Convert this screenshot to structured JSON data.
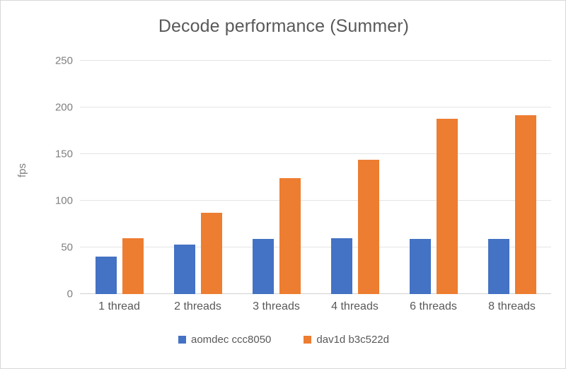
{
  "chart_data": {
    "type": "bar",
    "title": "Decode performance (Summer)",
    "xlabel": "",
    "ylabel": "fps",
    "categories": [
      "1 thread",
      "2 threads",
      "3 threads",
      "4 threads",
      "6 threads",
      "8 threads"
    ],
    "series": [
      {
        "name": "aomdec ccc8050",
        "color": "#4472C4",
        "values": [
          40,
          53,
          59,
          60,
          59,
          59
        ]
      },
      {
        "name": "dav1d b3c522d",
        "color": "#ED7D31",
        "values": [
          60,
          87,
          124,
          144,
          188,
          192
        ]
      }
    ],
    "ylim": [
      0,
      250
    ],
    "y_ticks": [
      0,
      50,
      100,
      150,
      200,
      250
    ],
    "y_tick_labels": [
      "0",
      "50",
      "100",
      "150",
      "200",
      "250"
    ],
    "grid": "horizontal",
    "legend_position": "bottom",
    "orientation": "vertical",
    "bar_mode": "grouped"
  },
  "colors": {
    "title_text": "#595959",
    "tick_text": "#7f7f7f",
    "gridline": "#E4E4E4",
    "border": "#D9D9D9",
    "background": "#FFFFFF"
  }
}
